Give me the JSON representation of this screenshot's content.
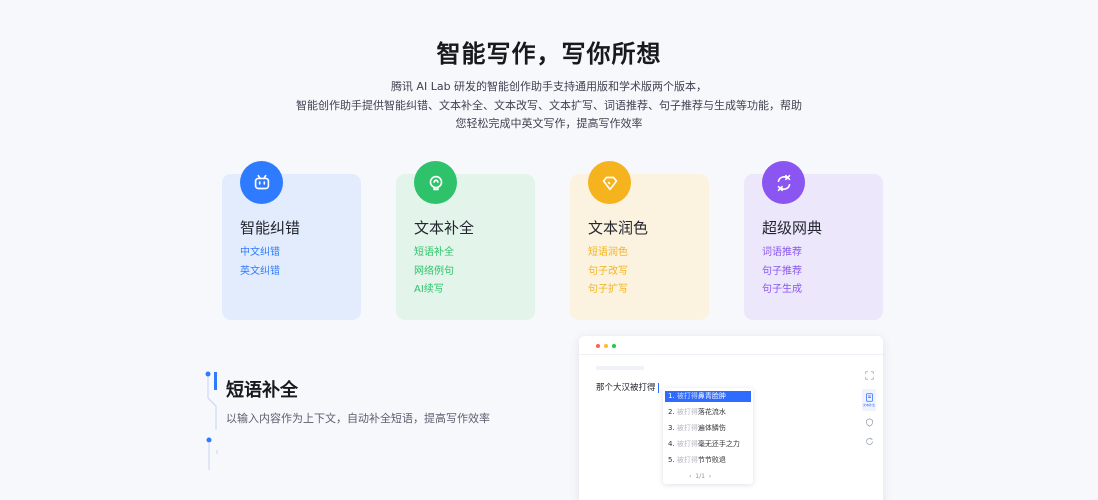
{
  "hero": {
    "title": "智能写作，写你所想",
    "desc_line1": "腾讯 AI Lab 研发的智能创作助手支持通用版和学术版两个版本，",
    "desc_line2": "智能创作助手提供智能纠错、文本补全、文本改写、文本扩写、词语推荐、句子推荐与生成等功能，帮助",
    "desc_line3": "您轻松完成中英文写作，提高写作效率"
  },
  "cards": [
    {
      "title": "智能纠错",
      "icon": "robot-face-icon",
      "color": "#2f7bff",
      "bg": "#e3ecfc",
      "items": [
        "中文纠错",
        "英文纠错"
      ]
    },
    {
      "title": "文本补全",
      "icon": "lightbulb-icon",
      "color": "#2ec36b",
      "bg": "#e3f5ea",
      "items": [
        "短语补全",
        "网络例句",
        "AI续写"
      ]
    },
    {
      "title": "文本润色",
      "icon": "diamond-icon",
      "color": "#f5b31d",
      "bg": "#fbf3df",
      "items": [
        "短语润色",
        "句子改写",
        "句子扩写"
      ]
    },
    {
      "title": "超级网典",
      "icon": "swap-icon",
      "color": "#8a55f0",
      "bg": "#ece7fb",
      "items": [
        "词语推荐",
        "句子推荐",
        "句子生成"
      ]
    }
  ],
  "feature": {
    "title": "短语补全",
    "desc": "以输入内容作为上下文，自动补全短语，提高写作效率"
  },
  "demo": {
    "input_text": "那个大汉被打得",
    "suggestions": [
      {
        "num": "1.",
        "prefix": "被打得",
        "text": "鼻青脸肿"
      },
      {
        "num": "2.",
        "prefix": "被打得",
        "text": "落花流水"
      },
      {
        "num": "3.",
        "prefix": "被打得",
        "text": "遍体鳞伤"
      },
      {
        "num": "4.",
        "prefix": "被打得",
        "text": "毫无还手之力"
      },
      {
        "num": "5.",
        "prefix": "被打得",
        "text": "节节败退"
      }
    ],
    "pager": {
      "prev": "‹",
      "page": "1",
      "sep": "/",
      "total": "1",
      "next": "›"
    },
    "window_dots": [
      "#ff5f57",
      "#febc2e",
      "#28c840"
    ],
    "side_tool_label": "文本补全",
    "accent": "#2f6bff"
  }
}
